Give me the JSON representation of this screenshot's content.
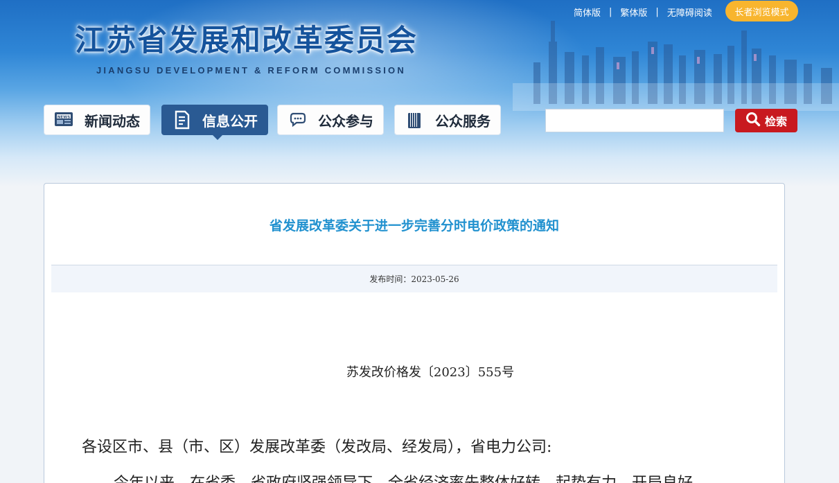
{
  "header": {
    "title": "江苏省发展和改革委员会",
    "subtitle": "JIANGSU DEVELOPMENT & REFORM COMMISSION",
    "top_links": [
      "简体版",
      "繁体版",
      "无障碍阅读"
    ],
    "separator": "|",
    "elder_mode_label": "长者浏览模式"
  },
  "nav": [
    {
      "label": "新闻动态",
      "icon": "news-icon"
    },
    {
      "label": "信息公开",
      "icon": "document-icon",
      "active": true
    },
    {
      "label": "公众参与",
      "icon": "chat-bubbles-icon"
    },
    {
      "label": "公众服务",
      "icon": "book-icon"
    }
  ],
  "search": {
    "value": "",
    "button_label": "检索",
    "icon": "search-icon"
  },
  "article": {
    "title": "省发展改革委关于进一步完善分时电价政策的通知",
    "publish_label": "发布时间：",
    "publish_date": "2023-05-26",
    "doc_number": "苏发改价格发〔2023〕555号",
    "salutation": "各设区市、县（市、区）发展改革委（发改局、经发局），省电力公司:",
    "paragraph_start": "今年以来，在省委、省政府坚强领导下，全省经济率先整体好转，起势有力，开局良好"
  },
  "colors": {
    "accent_title": "#2191cf",
    "nav_active": "#2a5a93",
    "search_button": "#c8191f",
    "elder_button": "#f8b52e",
    "site_title": "#15539c"
  }
}
